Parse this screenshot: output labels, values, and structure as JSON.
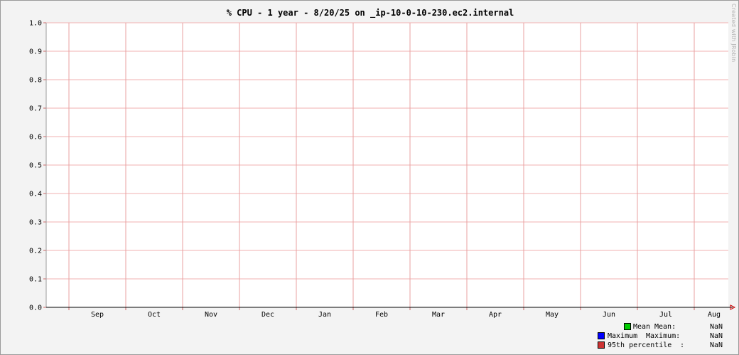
{
  "chart_data": {
    "type": "line",
    "title": "% CPU - 1 year - 8/20/25 on _ip-10-0-10-230.ec2.internal",
    "xlabel": "",
    "ylabel": "",
    "ylim": [
      0,
      1
    ],
    "y_ticks": [
      "0.0",
      "0.1",
      "0.2",
      "0.3",
      "0.4",
      "0.5",
      "0.6",
      "0.7",
      "0.8",
      "0.9",
      "1.0"
    ],
    "x_ticks": [
      "Sep",
      "Oct",
      "Nov",
      "Dec",
      "Jan",
      "Feb",
      "Mar",
      "Apr",
      "May",
      "Jun",
      "Jul",
      "Aug"
    ],
    "grid": true,
    "series": [
      {
        "name": "Mean",
        "color": "#00cc00",
        "values": []
      },
      {
        "name": "Maximum",
        "color": "#0000ff",
        "values": []
      },
      {
        "name": "95th percentile",
        "color": "#cc3333",
        "values": []
      }
    ]
  },
  "watermark": "Created with JRobin",
  "legend": {
    "items": [
      {
        "name": "Mean",
        "color": "#00cc00",
        "stat_label": "Mean:",
        "value": "NaN"
      },
      {
        "name": "Maximum",
        "color": "#0000ff",
        "stat_label": "Maximum:",
        "value": "NaN"
      },
      {
        "name": "95th percentile",
        "color": "#cc3333",
        "stat_label": ":",
        "value": "NaN"
      }
    ]
  }
}
